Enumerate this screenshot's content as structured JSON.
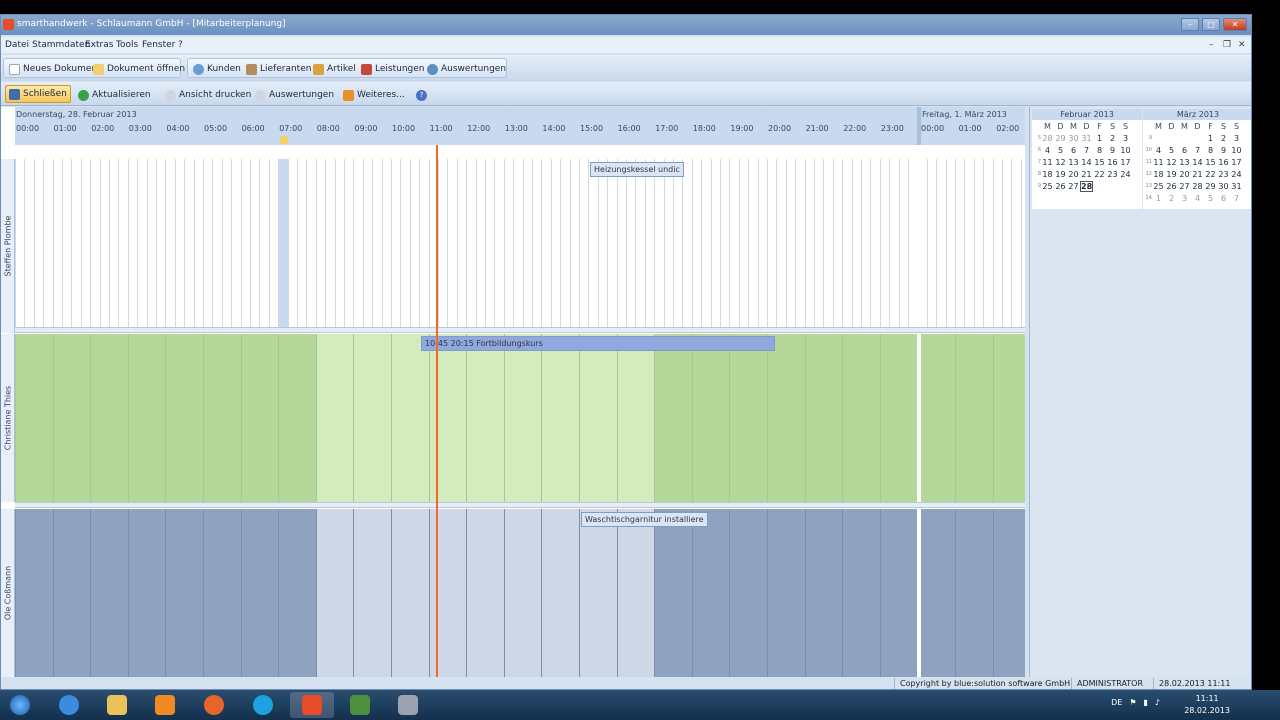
{
  "window": {
    "title": "smarthandwerk - Schlaumann GmbH - [Mitarbeiterplanung]"
  },
  "menu": [
    "Datei",
    "Stammdaten",
    "Extras",
    "Tools",
    "Fenster",
    "?"
  ],
  "toolbar1": {
    "neues_dokument": "Neues Dokument",
    "dokument_oeffnen": "Dokument öffnen",
    "kunden": "Kunden",
    "lieferanten": "Lieferanten",
    "artikel": "Artikel",
    "leistungen": "Leistungen",
    "auswertungen": "Auswertungen"
  },
  "toolbar2": {
    "schliessen": "Schließen",
    "aktualisieren": "Aktualisieren",
    "ansicht_drucken": "Ansicht drucken",
    "auswertungen": "Auswertungen",
    "weiteres": "Weiteres..."
  },
  "schedule": {
    "day1": "Donnerstag, 28. Februar 2013",
    "day2": "Freitag, 1. März 2013",
    "hours": [
      "00:00",
      "01:00",
      "02:00",
      "03:00",
      "04:00",
      "05:00",
      "06:00",
      "07:00",
      "08:00",
      "09:00",
      "10:00",
      "11:00",
      "12:00",
      "13:00",
      "14:00",
      "15:00",
      "16:00",
      "17:00",
      "18:00",
      "19:00",
      "20:00",
      "21:00",
      "22:00",
      "23:00",
      "00:00",
      "01:00",
      "02:00"
    ],
    "resources": [
      {
        "name": "Steffen Plombe",
        "event": "Heizungskessel undic"
      },
      {
        "name": "Christiane Thies",
        "event": "10:45 20:15 Fortbildungskurs"
      },
      {
        "name": "Ole Coßmann",
        "event": "Waschtischgarnitur installiere"
      }
    ]
  },
  "calendar": {
    "dow": [
      "M",
      "D",
      "M",
      "D",
      "F",
      "S",
      "S"
    ],
    "months": [
      {
        "name": "Februar 2013",
        "weeks": [
          {
            "wk": "5",
            "days": [
              "28",
              "29",
              "30",
              "31",
              "1",
              "2",
              "3"
            ]
          },
          {
            "wk": "6",
            "days": [
              "4",
              "5",
              "6",
              "7",
              "8",
              "9",
              "10"
            ]
          },
          {
            "wk": "7",
            "days": [
              "11",
              "12",
              "13",
              "14",
              "15",
              "16",
              "17"
            ]
          },
          {
            "wk": "8",
            "days": [
              "18",
              "19",
              "20",
              "21",
              "22",
              "23",
              "24"
            ]
          },
          {
            "wk": "9",
            "days": [
              "25",
              "26",
              "27",
              "28",
              "",
              "",
              ""
            ]
          }
        ]
      },
      {
        "name": "März 2013",
        "weeks": [
          {
            "wk": "9",
            "days": [
              "",
              "",
              "",
              "",
              "1",
              "2",
              "3"
            ]
          },
          {
            "wk": "10",
            "days": [
              "4",
              "5",
              "6",
              "7",
              "8",
              "9",
              "10"
            ]
          },
          {
            "wk": "11",
            "days": [
              "11",
              "12",
              "13",
              "14",
              "15",
              "16",
              "17"
            ]
          },
          {
            "wk": "12",
            "days": [
              "18",
              "19",
              "20",
              "21",
              "22",
              "23",
              "24"
            ]
          },
          {
            "wk": "13",
            "days": [
              "25",
              "26",
              "27",
              "28",
              "29",
              "30",
              "31"
            ]
          },
          {
            "wk": "14",
            "days": [
              "1",
              "2",
              "3",
              "4",
              "5",
              "6",
              "7"
            ]
          }
        ]
      }
    ]
  },
  "status": {
    "copyright": "Copyright by blue:solution software GmbH",
    "user": "ADMINISTRATOR",
    "datetime": "28.02.2013 11:11"
  },
  "taskbar": {
    "lang": "DE",
    "time": "11:11",
    "date": "28.02.2013"
  }
}
